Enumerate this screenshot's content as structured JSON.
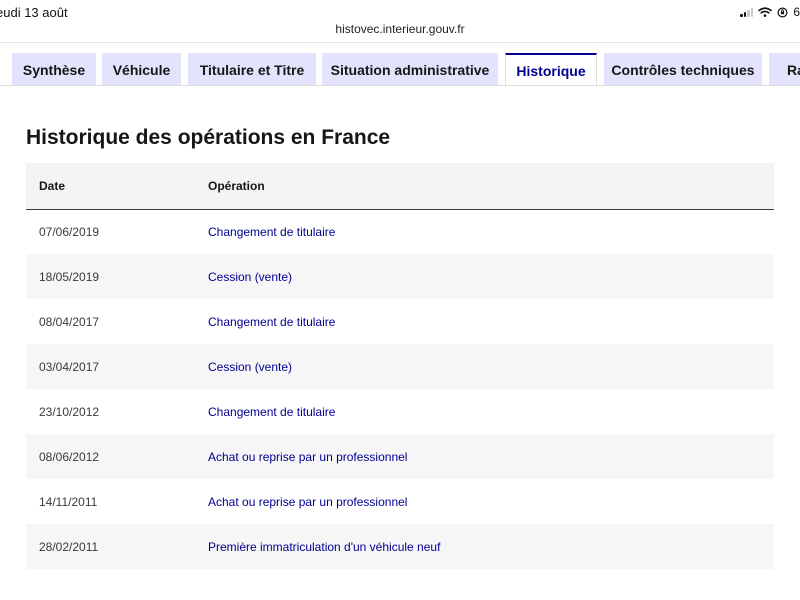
{
  "status_bar": {
    "date": "eudi 13 août",
    "battery_text": "6"
  },
  "browser": {
    "url": "histovec.interieur.gouv.fr"
  },
  "tabs": [
    {
      "label": "Synthèse",
      "active": false
    },
    {
      "label": "Véhicule",
      "active": false
    },
    {
      "label": "Titulaire et Titre",
      "active": false
    },
    {
      "label": "Situation administrative",
      "active": false
    },
    {
      "label": "Historique",
      "active": true
    },
    {
      "label": "Contrôles techniques",
      "active": false
    },
    {
      "label": "Rap",
      "active": false
    }
  ],
  "main": {
    "title": "Historique des opérations en France",
    "table": {
      "headers": {
        "date": "Date",
        "operation": "Opération"
      },
      "rows": [
        {
          "date": "07/06/2019",
          "operation": "Changement de titulaire"
        },
        {
          "date": "18/05/2019",
          "operation": "Cession (vente)"
        },
        {
          "date": "08/04/2017",
          "operation": "Changement de titulaire"
        },
        {
          "date": "03/04/2017",
          "operation": "Cession (vente)"
        },
        {
          "date": "23/10/2012",
          "operation": "Changement de titulaire"
        },
        {
          "date": "08/06/2012",
          "operation": "Achat ou reprise par un professionnel"
        },
        {
          "date": "14/11/2011",
          "operation": "Achat ou reprise par un professionnel"
        },
        {
          "date": "28/02/2011",
          "operation": "Première immatriculation d'un véhicule neuf"
        }
      ]
    }
  },
  "colors": {
    "accent": "#000091",
    "tab_background": "#e3e3fd",
    "header_background": "#f4f4f4",
    "stripe_background": "#f6f6f6"
  },
  "icons": [
    "signal-icon",
    "wifi-icon",
    "rotation-lock-icon"
  ]
}
